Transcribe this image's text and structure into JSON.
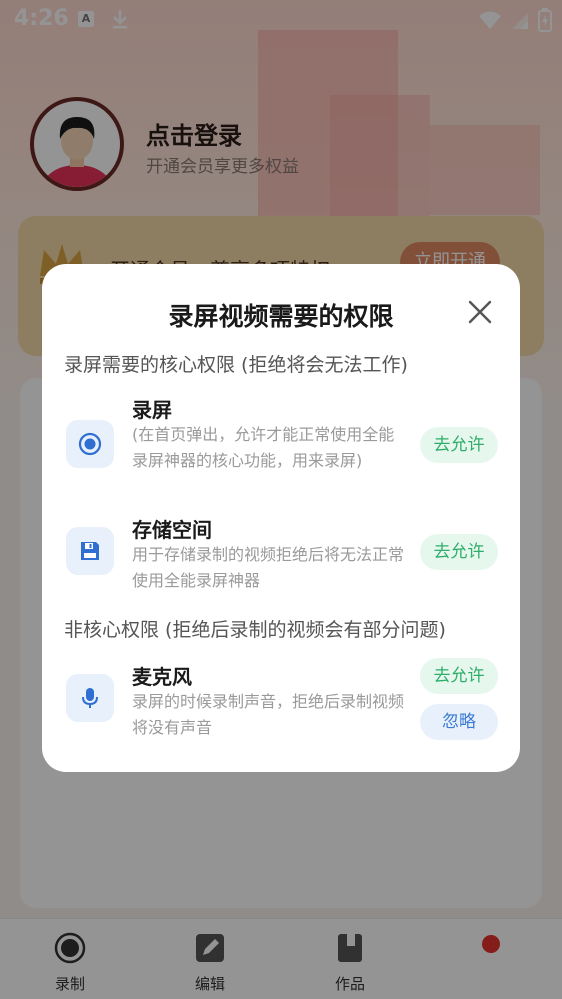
{
  "status_bar": {
    "time": "4:26",
    "notif_a": "A"
  },
  "profile": {
    "login_title": "点击登录",
    "login_subtitle": "开通会员享更多权益"
  },
  "vip_banner": {
    "text": "开通会员，尊享多项特权",
    "button": "立即开通"
  },
  "bottom_nav": {
    "items": [
      {
        "label": "录制",
        "icon": "record-icon"
      },
      {
        "label": "编辑",
        "icon": "edit-icon"
      },
      {
        "label": "作品",
        "icon": "works-icon"
      }
    ]
  },
  "dialog": {
    "title": "录屏视频需要的权限",
    "core_section_title": "录屏需要的核心权限 (拒绝将会无法工作)",
    "noncore_section_title": "非核心权限 (拒绝后录制的视频会有部分问题)",
    "permissions": [
      {
        "name": "录屏",
        "desc": "(在首页弹出，允许才能正常使用全能录屏神器的核心功能，用来录屏)",
        "allow": "去允许",
        "icon": "record-screen-icon"
      },
      {
        "name": "存储空间",
        "desc": "用于存储录制的视频拒绝后将无法正常使用全能录屏神器",
        "allow": "去允许",
        "icon": "storage-icon"
      },
      {
        "name": "麦克风",
        "desc": "录屏的时候录制声音，拒绝后录制视频将没有声音",
        "allow": "去允许",
        "ignore": "忽略",
        "icon": "microphone-icon"
      }
    ]
  },
  "colors": {
    "accent_blue": "#2f6fd1",
    "allow_green": "#2fae6a",
    "allow_bg": "#e6f7ee"
  }
}
